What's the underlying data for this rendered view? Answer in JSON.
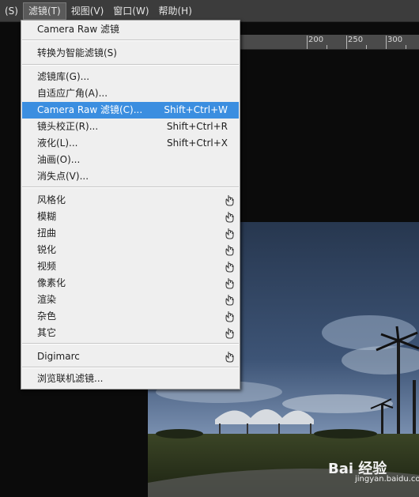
{
  "menubar": {
    "items": [
      {
        "label": "(S)"
      },
      {
        "label": "滤镜(T)"
      },
      {
        "label": "视图(V)"
      },
      {
        "label": "窗口(W)"
      },
      {
        "label": "帮助(H)"
      }
    ]
  },
  "ruler": {
    "ticks": [
      "200",
      "250",
      "300"
    ]
  },
  "filter_menu": {
    "last_filter": "Camera Raw 滤镜",
    "convert_smart": "转换为智能滤镜(S)",
    "group1": [
      {
        "label": "滤镜库(G)...",
        "shortcut": ""
      },
      {
        "label": "自适应广角(A)...",
        "shortcut": ""
      },
      {
        "label": "Camera Raw 滤镜(C)...",
        "shortcut": "Shift+Ctrl+W"
      },
      {
        "label": "镜头校正(R)...",
        "shortcut": "Shift+Ctrl+R"
      },
      {
        "label": "液化(L)...",
        "shortcut": "Shift+Ctrl+X"
      },
      {
        "label": "油画(O)...",
        "shortcut": ""
      },
      {
        "label": "消失点(V)...",
        "shortcut": ""
      }
    ],
    "submenus": [
      {
        "label": "风格化"
      },
      {
        "label": "模糊"
      },
      {
        "label": "扭曲"
      },
      {
        "label": "锐化"
      },
      {
        "label": "视频"
      },
      {
        "label": "像素化"
      },
      {
        "label": "渲染"
      },
      {
        "label": "杂色"
      },
      {
        "label": "其它"
      }
    ],
    "digimarc": "Digimarc",
    "browse_online": "浏览联机滤镜...",
    "highlight_color": "#3b8ee0",
    "submenu_icon": "cursor-hand-icon"
  },
  "watermark": {
    "site": "jingyan.baidu.com",
    "brand": "Bai 经验"
  }
}
